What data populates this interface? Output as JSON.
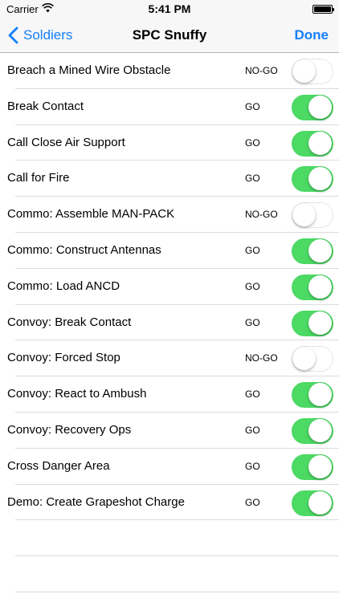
{
  "status_bar": {
    "carrier": "Carrier",
    "time": "5:41 PM"
  },
  "nav": {
    "back_label": "Soldiers",
    "title": "SPC Snuffy",
    "done_label": "Done"
  },
  "colors": {
    "accent": "#147efb",
    "switch_on": "#4cd964"
  },
  "tasks": [
    {
      "label": "Breach a Mined Wire Obstacle",
      "status": "NO-GO",
      "on": false
    },
    {
      "label": "Break Contact",
      "status": "GO",
      "on": true
    },
    {
      "label": "Call Close Air Support",
      "status": "GO",
      "on": true
    },
    {
      "label": "Call for Fire",
      "status": "GO",
      "on": true
    },
    {
      "label": "Commo: Assemble MAN-PACK",
      "status": "NO-GO",
      "on": false
    },
    {
      "label": "Commo: Construct Antennas",
      "status": "GO",
      "on": true
    },
    {
      "label": "Commo: Load ANCD",
      "status": "GO",
      "on": true
    },
    {
      "label": "Convoy: Break Contact",
      "status": "GO",
      "on": true
    },
    {
      "label": "Convoy: Forced Stop",
      "status": "NO-GO",
      "on": false
    },
    {
      "label": "Convoy: React to Ambush",
      "status": "GO",
      "on": true
    },
    {
      "label": "Convoy: Recovery Ops",
      "status": "GO",
      "on": true
    },
    {
      "label": "Cross Danger Area",
      "status": "GO",
      "on": true
    },
    {
      "label": "Demo: Create Grapeshot Charge",
      "status": "GO",
      "on": true
    }
  ]
}
